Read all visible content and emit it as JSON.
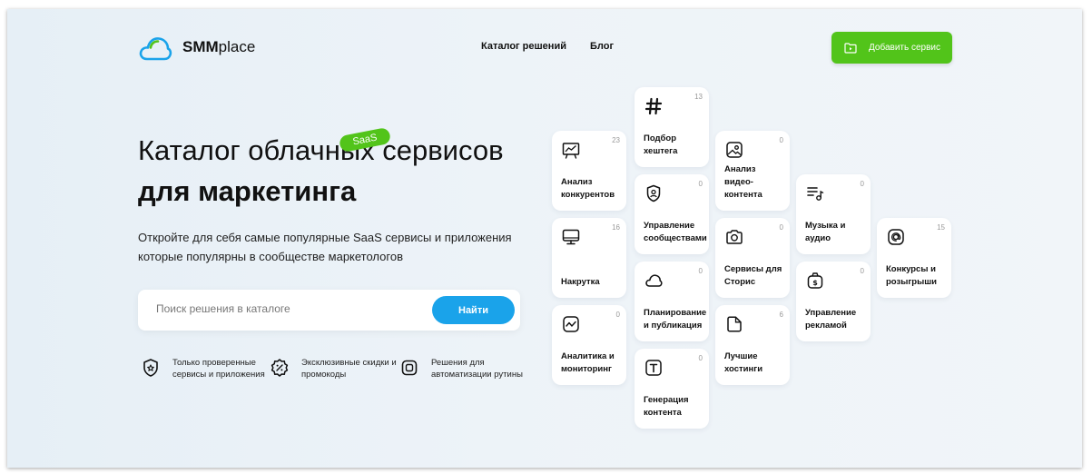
{
  "header": {
    "logo_bold": "SMM",
    "logo_rest": "place",
    "nav": [
      "Каталог решений",
      "Блог"
    ],
    "add_button": "Добавить сервис"
  },
  "hero": {
    "title_line1": "Каталог облачных сервисов",
    "title_line2": "для маркетинга",
    "badge": "SaaS",
    "description": "Откройте для себя самые популярные SaaS сервисы и приложения которые популярны в сообществе маркетологов"
  },
  "search": {
    "placeholder": "Поиск решения в каталоге",
    "value": "",
    "button": "Найти"
  },
  "features": [
    {
      "icon": "shield-icon",
      "text": "Только проверенные сервисы и приложения"
    },
    {
      "icon": "discount-icon",
      "text": "Эксклюзивные скидки и промокоды"
    },
    {
      "icon": "automation-icon",
      "text": "Решения для автоматизации рутины"
    }
  ],
  "categories": [
    {
      "label": "Подбор хештега",
      "count": "13",
      "icon": "hashtag-icon"
    },
    {
      "label": "Анализ конкурентов",
      "count": "23",
      "icon": "chart-board-icon"
    },
    {
      "label": "Управление сообществами",
      "count": "0",
      "icon": "user-badge-icon"
    },
    {
      "label": "Анализ видео-контента",
      "count": "0",
      "icon": "image-icon"
    },
    {
      "label": "Накрутка",
      "count": "16",
      "icon": "monitor-icon"
    },
    {
      "label": "Сервисы для Сторис",
      "count": "0",
      "icon": "camera-icon"
    },
    {
      "label": "Музыка и аудио",
      "count": "0",
      "icon": "music-list-icon"
    },
    {
      "label": "Планирование и публикация",
      "count": "0",
      "icon": "cloud-icon"
    },
    {
      "label": "Конкурсы и розыгрыши",
      "count": "15",
      "icon": "at-icon"
    },
    {
      "label": "Управление рекламой",
      "count": "0",
      "icon": "money-bag-icon"
    },
    {
      "label": "Аналитика и мониторинг",
      "count": "0",
      "icon": "analytics-icon"
    },
    {
      "label": "Лучшие хостинги",
      "count": "6",
      "icon": "folder-icon"
    },
    {
      "label": "Генерация контента",
      "count": "0",
      "icon": "text-icon"
    }
  ],
  "colors": {
    "accent_green": "#52c41a",
    "accent_blue": "#1aa3ea"
  }
}
